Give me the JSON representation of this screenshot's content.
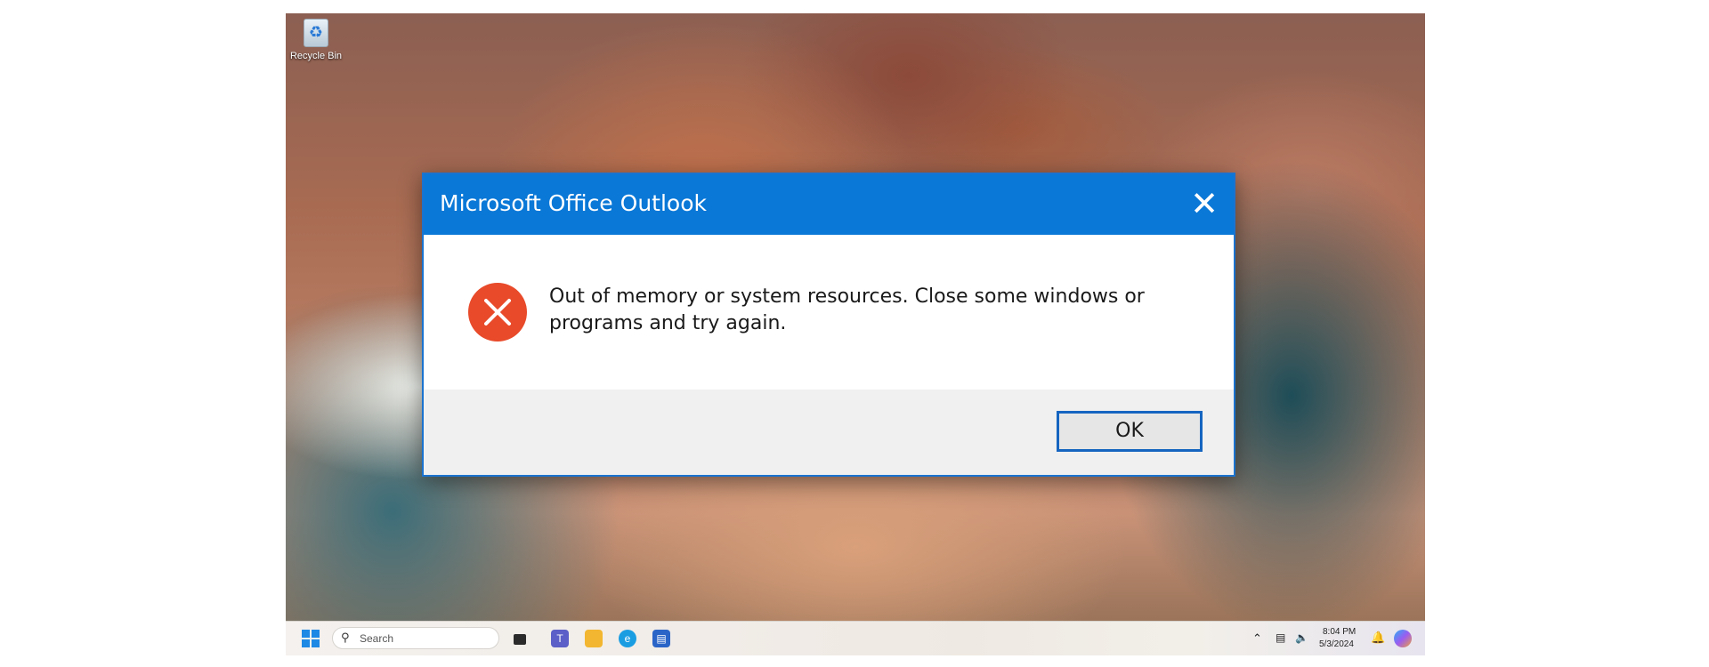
{
  "desktop": {
    "icons": [
      {
        "label": "Recycle Bin",
        "icon": "recycle-bin-icon"
      }
    ]
  },
  "dialog": {
    "title": "Microsoft Office Outlook",
    "close_symbol": "✕",
    "message": "Out of memory or system resources. Close some windows or programs and try again.",
    "ok_label": "OK",
    "icon": "error-icon",
    "colors": {
      "titlebar": "#0a78d7",
      "error": "#e84a2a",
      "footer": "#f0f0f0"
    }
  },
  "taskbar": {
    "search_placeholder": "Search",
    "apps": [
      "task-view-icon",
      "teams-icon",
      "file-explorer-icon",
      "edge-icon",
      "store-icon"
    ],
    "tray": {
      "time": "8:04 PM",
      "date": "5/3/2024"
    }
  }
}
